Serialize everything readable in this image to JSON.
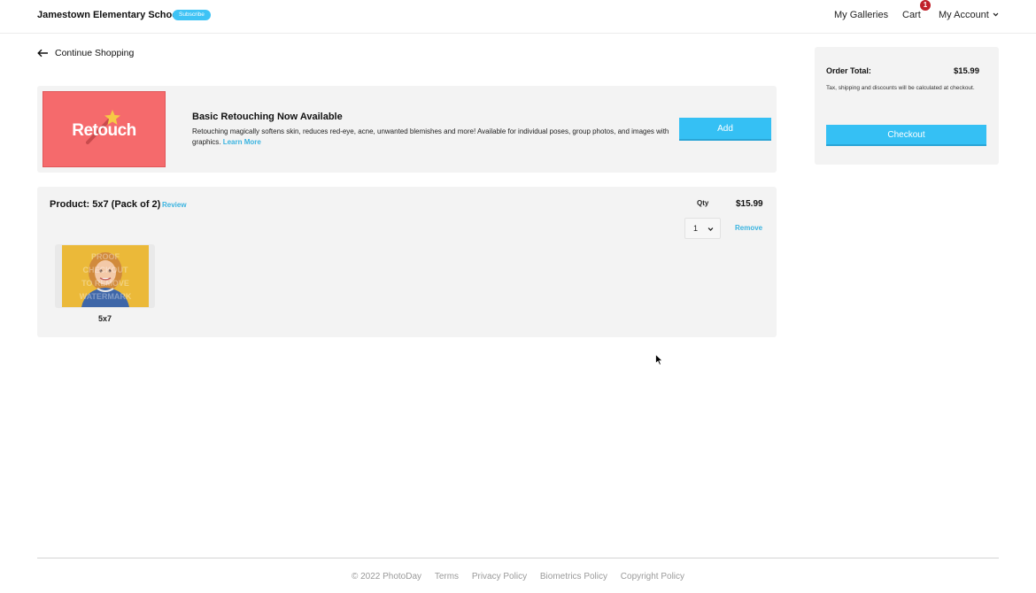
{
  "header": {
    "school_name": "Jamestown Elementary School",
    "subscribe_label": "Subscribe",
    "nav": {
      "galleries": "My Galleries",
      "cart": "Cart",
      "cart_count": "1",
      "account": "My Account"
    }
  },
  "continue_shopping": "Continue Shopping",
  "promo": {
    "image_text": "Retouch",
    "title": "Basic Retouching Now Available",
    "description": "Retouching magically softens skin, reduces red-eye, acne, unwanted blemishes and more! Available for individual poses, group photos, and images with graphics.",
    "learn_more": "Learn More",
    "add_label": "Add"
  },
  "product": {
    "title": "Product: 5x7 (Pack of 2)",
    "review_label": "Review",
    "qty_label": "Qty",
    "qty_value": "1",
    "price": "$15.99",
    "remove_label": "Remove",
    "thumbnail_label": "5x7",
    "watermark_lines": [
      "PROOF",
      "CHECKOUT",
      "TO REMOVE",
      "WATERMARK"
    ]
  },
  "summary": {
    "order_total_label": "Order Total:",
    "order_total_value": "$15.99",
    "note": "Tax, shipping and discounts will be calculated at checkout.",
    "checkout_label": "Checkout"
  },
  "footer": {
    "copyright": "© 2022 PhotoDay",
    "links": [
      "Terms",
      "Privacy Policy",
      "Biometrics Policy",
      "Copyright Policy"
    ]
  },
  "colors": {
    "accent": "#35c0f4",
    "link": "#3bb4e0",
    "badge": "#c0202a",
    "promo_image": "#f56a6c"
  }
}
